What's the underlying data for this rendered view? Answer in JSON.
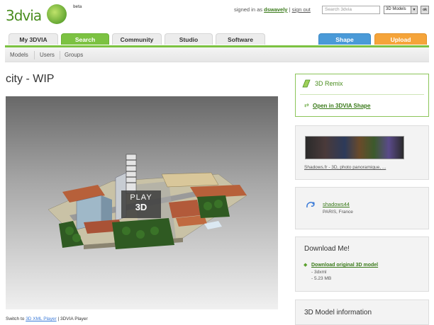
{
  "brand": {
    "logo_text": "3dvia",
    "beta": "beta"
  },
  "header": {
    "signed_in_prefix": "signed in as",
    "username": "dswavely",
    "separator": "|",
    "sign_out": "sign out",
    "search_placeholder": "Search 3dvia",
    "search_scope": "3D Models",
    "ok": "ok"
  },
  "tabs": [
    {
      "label": "My 3DVIA"
    },
    {
      "label": "Search"
    },
    {
      "label": "Community"
    },
    {
      "label": "Studio"
    },
    {
      "label": "Software"
    },
    {
      "label": "Shape"
    },
    {
      "label": "Upload"
    }
  ],
  "subnav": [
    "Models",
    "Users",
    "Groups"
  ],
  "page": {
    "title": "city - WIP"
  },
  "viewer": {
    "play_line1": "PLAY",
    "play_line2": "3D"
  },
  "player_switch": {
    "prefix": "Switch to",
    "link": "3D XML Player",
    "sep": "|",
    "current": "3DVIA Player"
  },
  "remix": {
    "title": "3D Remix",
    "link": "Open in 3DVIA Shape"
  },
  "ad": {
    "caption": "Shadows.fr - 3D, photo panoramique, ..."
  },
  "author": {
    "name": "shadows44",
    "location": "PARIS, France"
  },
  "download": {
    "title": "Download Me!",
    "link": "Download original 3D model",
    "format": "- 3dxml",
    "size": "- 5.23 MB"
  },
  "info": {
    "title": "3D Model information"
  },
  "colors": {
    "green": "#7cc242",
    "blue": "#4a9ad8",
    "orange": "#f5a43a"
  }
}
